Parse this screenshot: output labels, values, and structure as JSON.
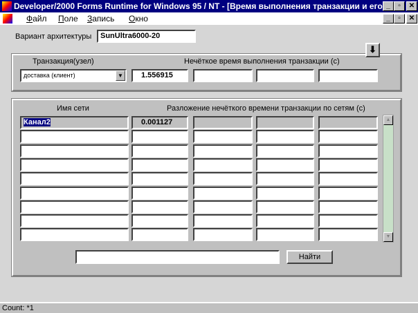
{
  "window": {
    "title": "Developer/2000 Forms Runtime for Windows 95 / NT - [Время выполнения транзакции и его \"...",
    "minimize": "_",
    "maximize": "▫",
    "close": "✕"
  },
  "menu": [
    {
      "label": "Файл",
      "key": "Ф",
      "rest": "айл"
    },
    {
      "label": "Поле",
      "key": "П",
      "rest": "оле"
    },
    {
      "label": "Запись",
      "key": "З",
      "rest": "апись"
    },
    {
      "label": "Окно",
      "key": "О",
      "rest": "кно"
    }
  ],
  "form": {
    "arch_label": "Вариант архитектуры",
    "arch_value": "SunUltra6000-20",
    "arrow_button": "⬇",
    "transaction_label": "Транзакция(узел)",
    "transaction_value": "доставка (клиент)",
    "time_label": "Нечёткое время выполнения  транзакции (с)",
    "time_values": [
      "1.556915",
      "",
      "",
      ""
    ],
    "net_name_label": "Имя сети",
    "breakdown_label": "Разложение нечёткого времени транзакции по сетям (с)",
    "rows": [
      {
        "name": "Канал2",
        "values": [
          "0.001127",
          "",
          "",
          ""
        ]
      },
      {
        "name": "",
        "values": [
          "",
          "",
          "",
          ""
        ]
      },
      {
        "name": "",
        "values": [
          "",
          "",
          "",
          ""
        ]
      },
      {
        "name": "",
        "values": [
          "",
          "",
          "",
          ""
        ]
      },
      {
        "name": "",
        "values": [
          "",
          "",
          "",
          ""
        ]
      },
      {
        "name": "",
        "values": [
          "",
          "",
          "",
          ""
        ]
      },
      {
        "name": "",
        "values": [
          "",
          "",
          "",
          ""
        ]
      },
      {
        "name": "",
        "values": [
          "",
          "",
          "",
          ""
        ]
      },
      {
        "name": "",
        "values": [
          "",
          "",
          "",
          ""
        ]
      }
    ],
    "search_value": "",
    "find_button": "Найти"
  },
  "status": {
    "text": "Count: *1"
  },
  "colors": {
    "title": "#000080",
    "scroll_track": "#c8e0c8",
    "panel": "#c0c0c0"
  }
}
